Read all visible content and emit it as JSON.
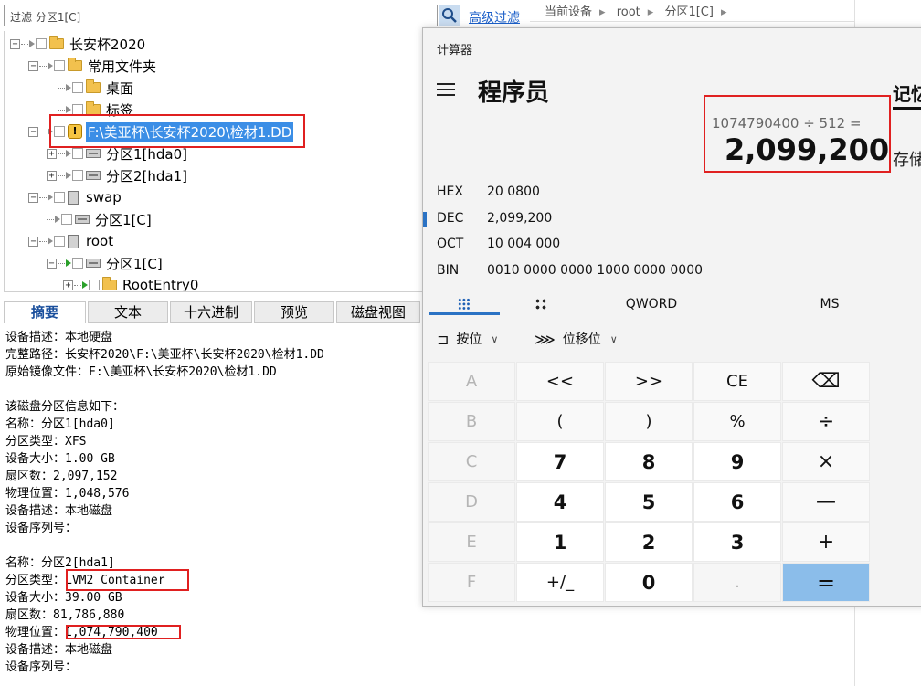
{
  "left": {
    "filter_placeholder": "过滤 分区1[C]",
    "adv_filter": "高级过滤",
    "breadcrumb": [
      "当前设备",
      "root",
      "分区1[C]"
    ],
    "tree": [
      {
        "label": "长安杯2020"
      },
      {
        "label": "常用文件夹"
      },
      {
        "label": "桌面"
      },
      {
        "label": "标签"
      },
      {
        "label": "F:\\美亚杯\\长安杯2020\\检材1.DD",
        "selected": true
      },
      {
        "label": "分区1[hda0]"
      },
      {
        "label": "分区2[hda1]"
      },
      {
        "label": "swap"
      },
      {
        "label": "分区1[C]"
      },
      {
        "label": "root"
      },
      {
        "label": "分区1[C]"
      },
      {
        "label": "RootEntry0"
      }
    ],
    "tabs": [
      "摘要",
      "文本",
      "十六进制",
      "预览",
      "磁盘视图"
    ],
    "active_tab": "摘要",
    "summary_lines": [
      "设备描述：本地硬盘",
      "完整路径：长安杯2020\\F:\\美亚杯\\长安杯2020\\检材1.DD",
      "原始镜像文件：F:\\美亚杯\\长安杯2020\\检材1.DD",
      "",
      "该磁盘分区信息如下：",
      "名称：分区1[hda0]",
      "分区类型：XFS",
      "设备大小：1.00 GB",
      "扇区数：2,097,152",
      "物理位置：1,048,576",
      "设备描述：本地磁盘",
      "设备序列号：",
      "",
      "名称：分区2[hda1]",
      "分区类型：LVM2 Container",
      "设备大小：39.00 GB",
      "扇区数：81,786,880",
      "物理位置：1,074,790,400",
      "设备描述：本地磁盘",
      "设备序列号："
    ]
  },
  "calc": {
    "title": "计算器",
    "mode": "程序员",
    "memory": "记忆",
    "store": "存储",
    "expression": "1074790400 ÷ 512 =",
    "result": "2,099,200",
    "radix": [
      {
        "key": "HEX",
        "value": "20 0800"
      },
      {
        "key": "DEC",
        "value": "2,099,200"
      },
      {
        "key": "OCT",
        "value": "10 004 000"
      },
      {
        "key": "BIN",
        "value": "0010 0000 0000 1000 0000 0000"
      }
    ],
    "word_size": "QWORD",
    "ms": "MS",
    "bitwise": "按位",
    "bitshift": "位移位",
    "keys": [
      [
        "A",
        "<<",
        ">>",
        "CE",
        "⌫"
      ],
      [
        "B",
        "(",
        ")",
        "%",
        "÷"
      ],
      [
        "C",
        "7",
        "8",
        "9",
        "×"
      ],
      [
        "D",
        "4",
        "5",
        "6",
        "—"
      ],
      [
        "E",
        "1",
        "2",
        "3",
        "+"
      ],
      [
        "F",
        "+/_",
        "0",
        ".",
        "="
      ]
    ],
    "colors": {
      "equals": "#8bbdea",
      "accent": "#2a72c4",
      "highlight_box": "#e02020"
    }
  }
}
